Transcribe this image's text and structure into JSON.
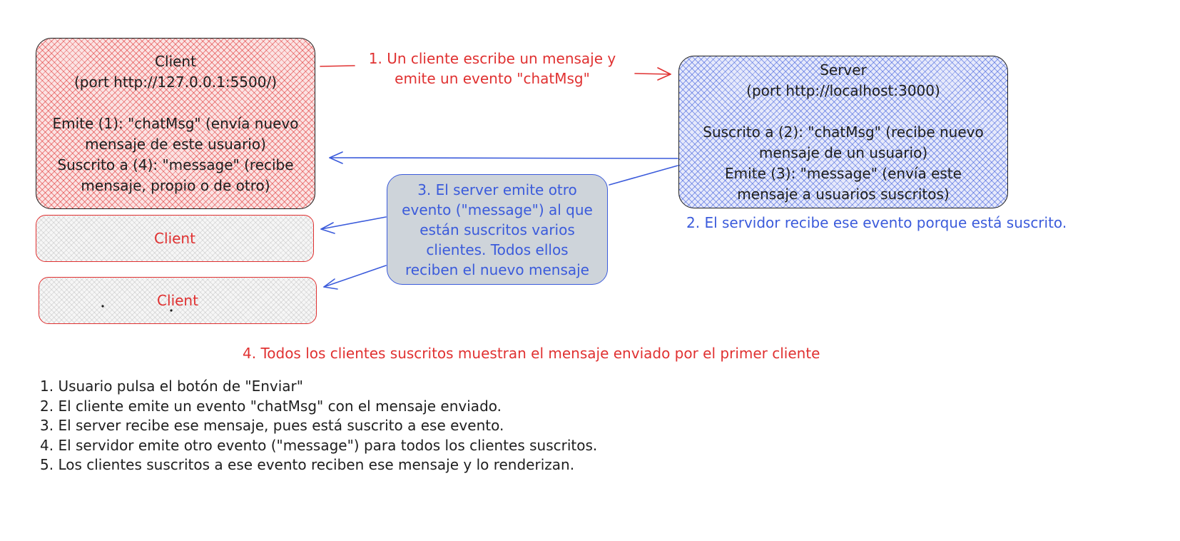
{
  "client_main": {
    "title": "Client",
    "port": "(port http://127.0.0.1:5500/)",
    "lines": [
      "Emite (1): \"chatMsg\" (envía nuevo",
      "mensaje de este usuario)",
      "Suscrito a (4): \"message\" (recibe",
      "mensaje, propio o de otro)"
    ]
  },
  "client_2": {
    "title": "Client"
  },
  "client_3": {
    "title": "Client"
  },
  "server": {
    "title": "Server",
    "port": "(port http://localhost:3000)",
    "lines": [
      "Suscrito a (2): \"chatMsg\" (recibe nuevo",
      "mensaje de un usuario)",
      "Emite (3): \"message\" (envía este",
      "mensaje a usuarios suscritos)"
    ]
  },
  "annotations": {
    "step1": [
      "1. Un cliente escribe un mensaje y",
      "emite un evento \"chatMsg\""
    ],
    "step2": "2. El servidor recibe ese evento porque está suscrito.",
    "step3": [
      "3. El server emite otro",
      "evento (\"message\") al que",
      "están suscritos varios",
      "clientes. Todos ellos",
      "reciben el nuevo mensaje"
    ],
    "step4": "4. Todos los clientes suscritos muestran el mensaje enviado por el primer cliente"
  },
  "steps_list": [
    "1. Usuario pulsa el botón de \"Enviar\"",
    "2. El cliente emite un evento \"chatMsg\" con el mensaje enviado.",
    "3. El server recibe ese mensaje, pues está suscrito a ese evento.",
    "4. El servidor emite otro evento (\"message\") para todos los clientes suscritos.",
    "5. Los clientes suscritos a ese evento reciben ese mensaje y lo renderizan."
  ],
  "colors": {
    "red": "#e03131",
    "blue": "#3b5bdb",
    "stroke": "#1e1e1e",
    "note_fill": "#ced4da"
  }
}
